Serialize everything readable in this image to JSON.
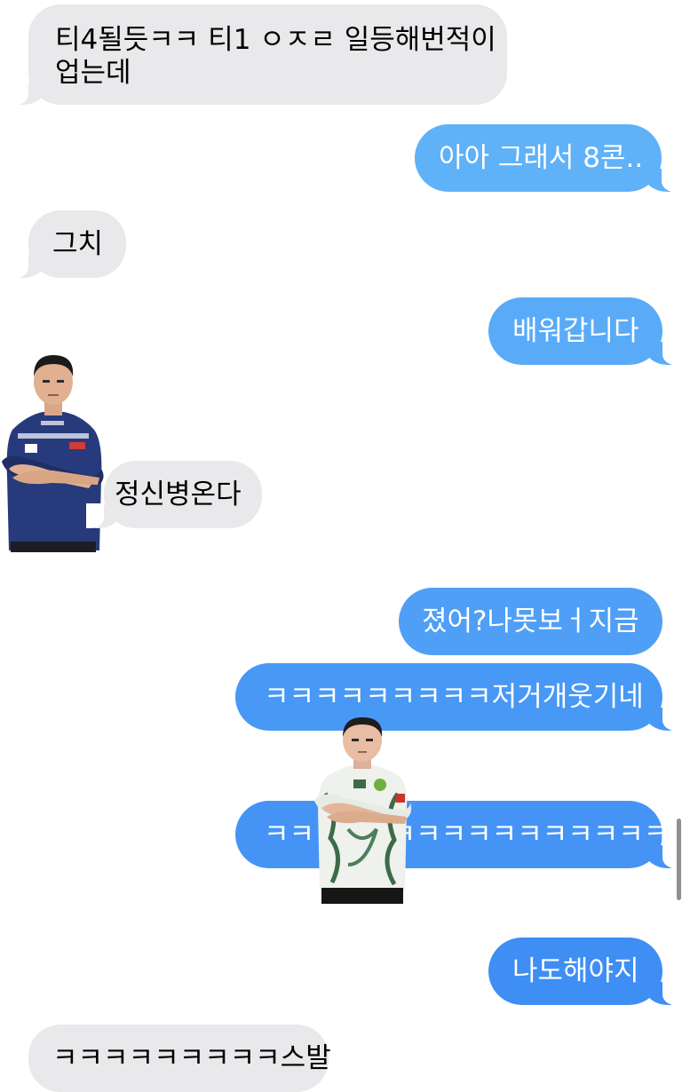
{
  "colors": {
    "received_bg": "#e9e9eb",
    "sent_light": "#62b2f8",
    "sent_mid": "#4a9df6",
    "sent_dark": "#3e8ef3",
    "background": "#ffffff",
    "jersey_navy": "#263a7c",
    "jersey_white": "#eef1ec",
    "jersey_green": "#3c6b48"
  },
  "messages": [
    {
      "direction": "received",
      "lines": [
        "티4될듯ㅋㅋ 티1 ㅇㅈㄹ 일등해번적이",
        "업는데"
      ]
    },
    {
      "direction": "sent",
      "lines": [
        "아아 그래서 8콘.."
      ]
    },
    {
      "direction": "received",
      "lines": [
        "그치"
      ]
    },
    {
      "direction": "sent",
      "lines": [
        "배워갑니다"
      ]
    },
    {
      "direction": "received",
      "lines": [
        "정신병온다"
      ]
    },
    {
      "direction": "sent",
      "lines": [
        "졌어?나못보ㅓ지금"
      ]
    },
    {
      "direction": "sent",
      "lines": [
        "ㅋㅋㅋㅋㅋㅋㅋㅋㅋ저거개웃기네"
      ]
    },
    {
      "direction": "sent",
      "lines": [
        "ㅋㅋㅋㅋㅋㅋㅋㅋㅋㅋㅋㅋㅋㅋㅋㅋ"
      ]
    },
    {
      "direction": "sent",
      "lines": [
        "나도해야지"
      ]
    },
    {
      "direction": "received",
      "lines": [
        "ㅋㅋㅋㅋㅋㅋㅋㅋㅋ스발"
      ]
    }
  ],
  "stickers": [
    {
      "name": "player-sticker-t1",
      "description_icon": "person-sticker"
    },
    {
      "name": "player-sticker-green",
      "description_icon": "person-sticker"
    }
  ]
}
